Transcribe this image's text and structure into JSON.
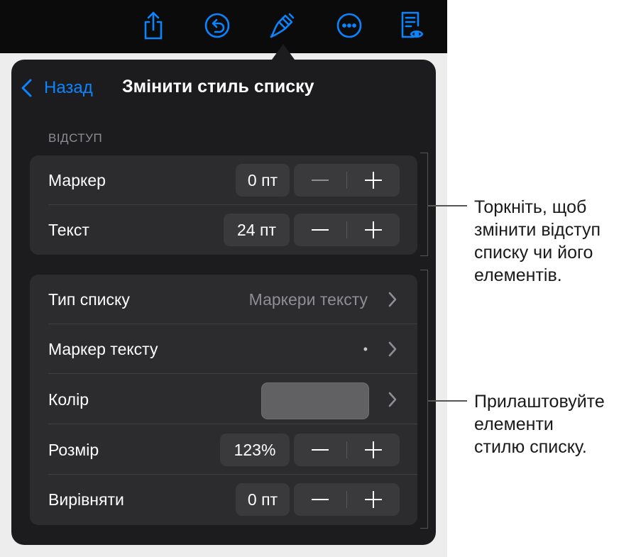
{
  "toolbar": {
    "icons": [
      "share-icon",
      "undo-icon",
      "paintbrush-icon",
      "more-icon",
      "reader-view-icon"
    ],
    "accent_color": "#0a84ff"
  },
  "nav": {
    "back_label": "Назад",
    "title": "Змінити стиль списку"
  },
  "indent_section": {
    "header": "ВІДСТУП",
    "rows": [
      {
        "label": "Маркер",
        "value": "0 пт"
      },
      {
        "label": "Текст",
        "value": "24 пт"
      }
    ]
  },
  "style_section": {
    "list_type": {
      "label": "Тип списку",
      "value": "Маркери тексту"
    },
    "text_bullet": {
      "label": "Маркер тексту",
      "value": "•"
    },
    "color": {
      "label": "Колір",
      "swatch": "#616163"
    },
    "size": {
      "label": "Розмір",
      "value": "123%"
    },
    "align": {
      "label": "Вирівняти",
      "value": "0 пт"
    }
  },
  "callouts": {
    "indent": "Торкніть, щоб\nзмінити відступ\nсписку чи його\nелементів.",
    "style": "Прилаштовуйте\nелементи\nстилю списку."
  }
}
